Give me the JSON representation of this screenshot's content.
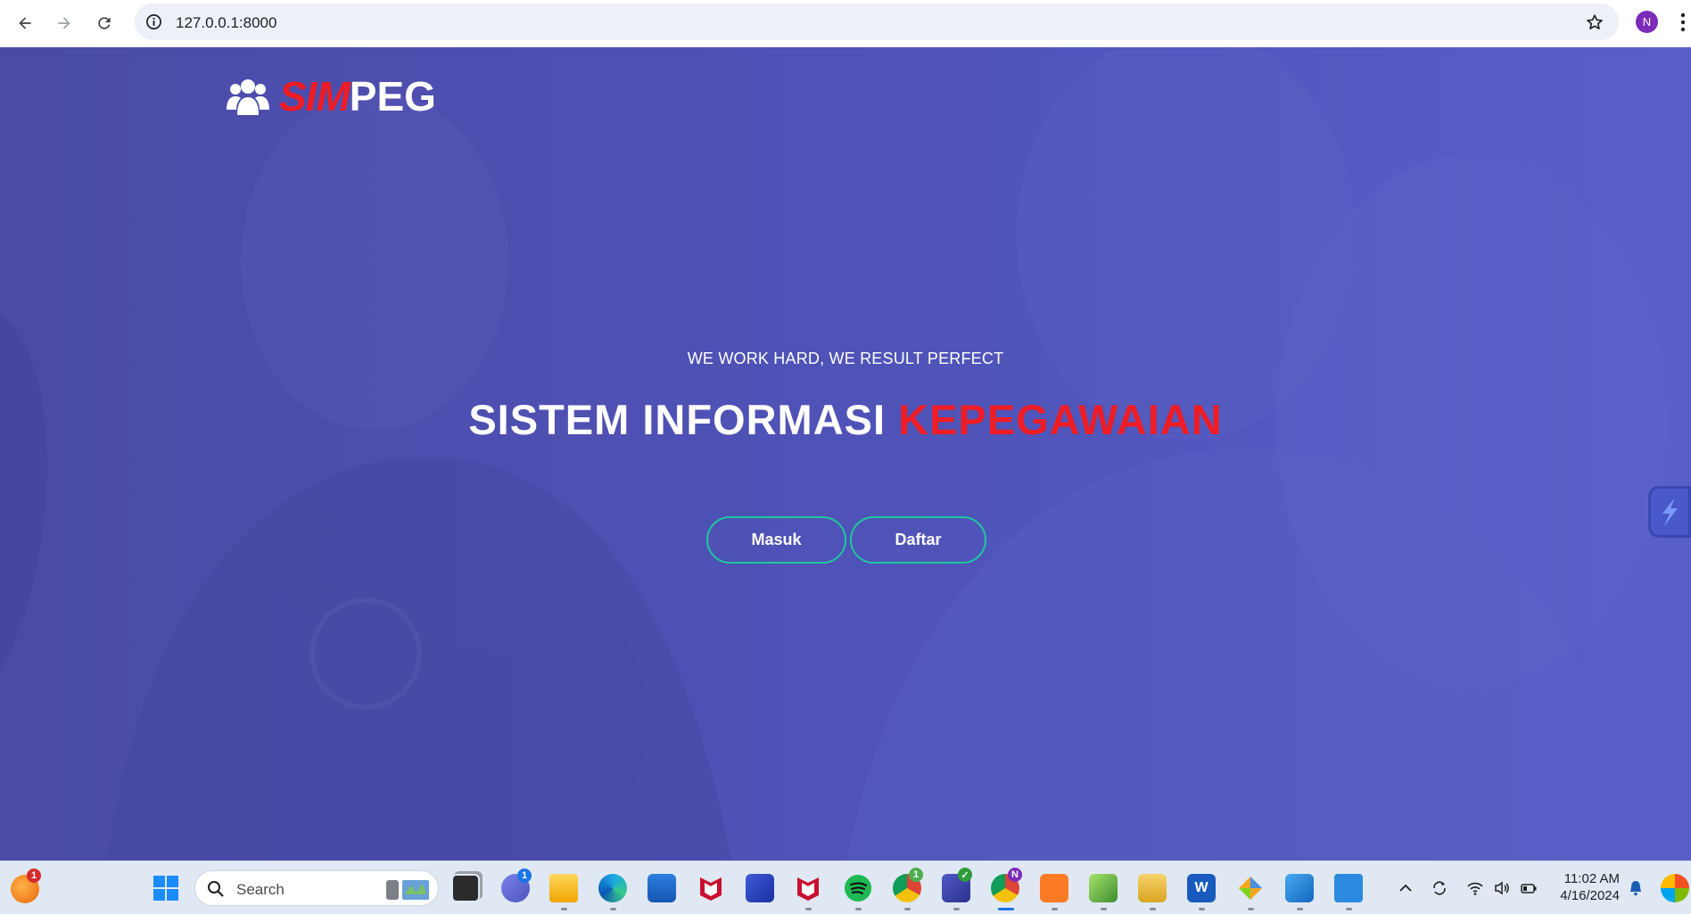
{
  "browser": {
    "url": "127.0.0.1:8000",
    "profile_initial": "N"
  },
  "page": {
    "brand_sim": "SIM",
    "brand_peg": "PEG",
    "tagline": "WE WORK HARD, WE RESULT PERFECT",
    "headline_white": "SISTEM INFORMASI",
    "headline_red": "KEPEGAWAIAN",
    "login_label": "Masuk",
    "register_label": "Daftar",
    "colors": {
      "overlay": "#4e51b4",
      "accent_red": "#ee1c25",
      "button_border": "#1fc7a0"
    }
  },
  "taskbar": {
    "search_label": "Search",
    "time": "11:02 AM",
    "date": "4/16/2024",
    "badges": {
      "widgets": "1",
      "teams_chat": "1",
      "chrome_green": "1"
    },
    "apps": [
      "widgets-icon",
      "start-icon",
      "search-box",
      "task-view-icon",
      "teams-chat-icon",
      "file-explorer-icon",
      "edge-icon",
      "store-icon",
      "mcafee-icon",
      "vscode-like-icon",
      "mcafee-icon-2",
      "spotify-icon",
      "chrome-icon",
      "teams-new-icon",
      "chrome-profile-icon",
      "xampp-icon",
      "notepadpp-icon",
      "folder-arrow-icon",
      "word-icon",
      "gem-icon",
      "photos-icon",
      "notepad-icon"
    ]
  }
}
